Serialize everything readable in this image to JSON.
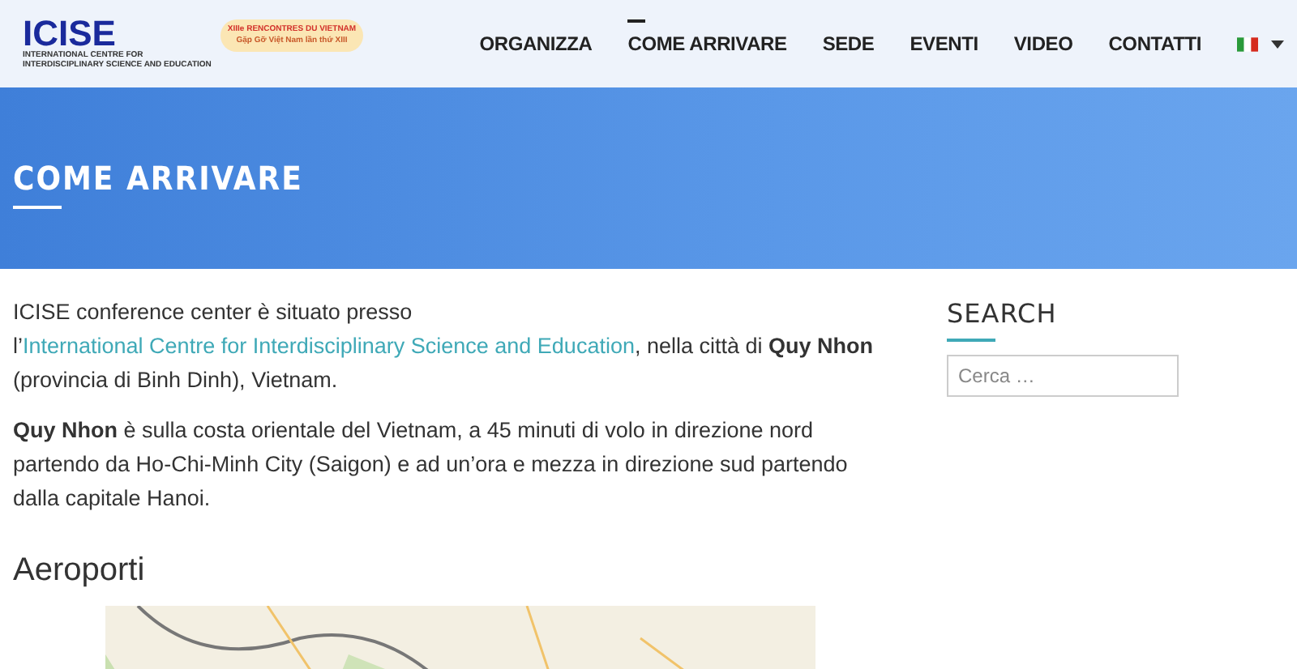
{
  "logo": {
    "title": "ICISE",
    "subtitle_lines": [
      "INTERNATIONAL CENTRE FOR",
      "INTERDISCIPLINARY SCIENCE AND EDUCATION"
    ],
    "event_lines": [
      "XIIIe RENCONTRES DU VIETNAM",
      "Gặp Gỡ Việt Nam lần thứ XIII"
    ]
  },
  "nav": [
    {
      "label": "ORGANIZZA",
      "selected": false
    },
    {
      "label": "COME ARRIVARE",
      "selected": true
    },
    {
      "label": "SEDE",
      "selected": false
    },
    {
      "label": "EVENTI",
      "selected": false
    },
    {
      "label": "VIDEO",
      "selected": false
    },
    {
      "label": "CONTATTI",
      "selected": false
    }
  ],
  "banner": {
    "title": "COME ARRIVARE"
  },
  "content": {
    "paragraphs": [
      [
        {
          "text": "ICISE conference center è situato presso l’"
        },
        {
          "text": "International Centre for Interdisciplinary Science and Education",
          "kind": "link"
        },
        {
          "text": ", nella città di "
        },
        {
          "text": "Quy Nhon",
          "kind": "bold"
        },
        {
          "text": " (provincia di Binh Dinh), Vietnam."
        }
      ],
      [
        {
          "text": "Quy Nhon",
          "kind": "bold"
        },
        {
          "text": " è sulla costa orientale del Vietnam, a 45 minuti di volo in direzione nord partendo da Ho-Chi-Minh City (Saigon) e ad un’ora e mezza in direzione sud partendo dalla capitale Hanoi."
        }
      ]
    ],
    "heading": "Aeroporti",
    "map": {
      "kind": "picture"
    }
  },
  "sidebar": {
    "title": "SEARCH",
    "search": {
      "placeholder": "Cerca …"
    }
  }
}
